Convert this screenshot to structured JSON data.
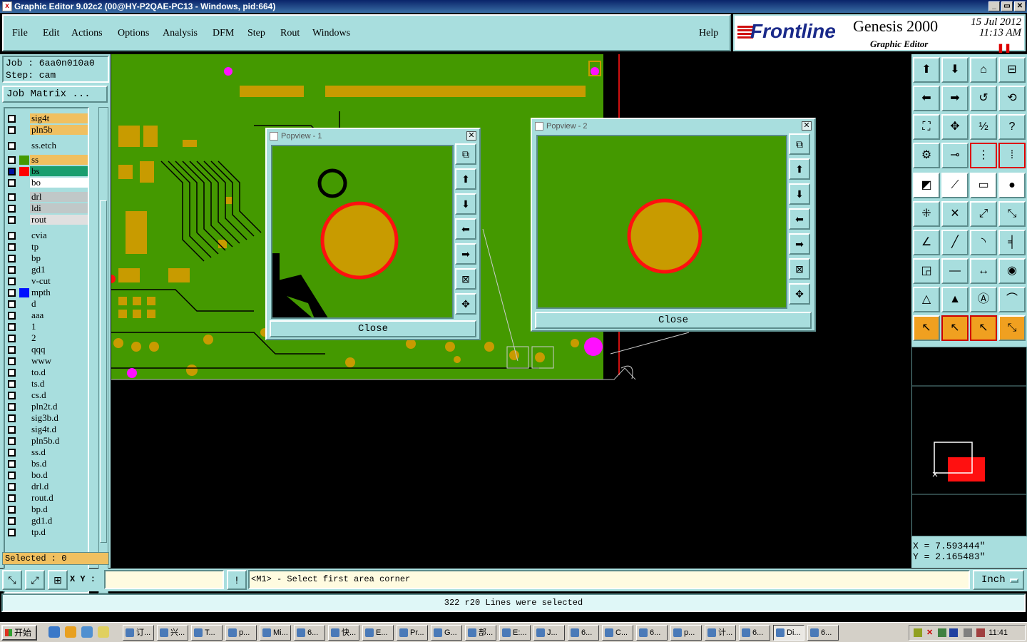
{
  "window": {
    "title": "Graphic Editor 9.02c2 (00@HY-P2QAE-PC13 - Windows, pid:664)",
    "controls": [
      "_",
      "▭",
      "✕"
    ]
  },
  "menu": {
    "items": [
      "File",
      "Edit",
      "Actions",
      "Options",
      "Analysis",
      "DFM",
      "Step",
      "Rout",
      "Windows"
    ],
    "help": "Help"
  },
  "brand": {
    "logo": "Frontline",
    "product": "Genesis 2000",
    "subtitle": "Graphic Editor",
    "date": "15 Jul 2012",
    "time": "11:13 AM"
  },
  "job": {
    "job_line": "Job : 6aa0n010a0",
    "step_line": "Step: cam",
    "matrix_button": "Job Matrix ..."
  },
  "layers": [
    {
      "name": "sig4t",
      "color": "#f0c060"
    },
    {
      "name": "pln5b",
      "color": "#f0c060"
    },
    {
      "name": "ss.etch",
      "color": "#a8dede"
    },
    {
      "name": "ss",
      "color": "#f0c060",
      "swatch": "#449900"
    },
    {
      "name": "bs",
      "color": "#1a9e6e",
      "swatch": "#ff0000",
      "active": true
    },
    {
      "name": "bo",
      "color": "#ffffff"
    },
    {
      "name": "drl",
      "color": "#c0c8c8"
    },
    {
      "name": "ldi",
      "color": "#c0c8c8"
    },
    {
      "name": "rout",
      "color": "#e0e0e0"
    },
    {
      "name": "cvia",
      "color": "#a8dede"
    },
    {
      "name": "tp",
      "color": "#a8dede"
    },
    {
      "name": "bp",
      "color": "#a8dede"
    },
    {
      "name": "gd1",
      "color": "#a8dede"
    },
    {
      "name": "v-cut",
      "color": "#a8dede"
    },
    {
      "name": "mpth",
      "color": "#a8dede",
      "swatch": "#0010ff"
    },
    {
      "name": "d",
      "color": "#a8dede"
    },
    {
      "name": "aaa",
      "color": "#a8dede"
    },
    {
      "name": "1",
      "color": "#a8dede"
    },
    {
      "name": "2",
      "color": "#a8dede"
    },
    {
      "name": "qqq",
      "color": "#a8dede"
    },
    {
      "name": "www",
      "color": "#a8dede"
    },
    {
      "name": "to.d",
      "color": "#a8dede"
    },
    {
      "name": "ts.d",
      "color": "#a8dede"
    },
    {
      "name": "cs.d",
      "color": "#a8dede"
    },
    {
      "name": "pln2t.d",
      "color": "#a8dede"
    },
    {
      "name": "sig3b.d",
      "color": "#a8dede"
    },
    {
      "name": "sig4t.d",
      "color": "#a8dede"
    },
    {
      "name": "pln5b.d",
      "color": "#a8dede"
    },
    {
      "name": "ss.d",
      "color": "#a8dede"
    },
    {
      "name": "bs.d",
      "color": "#a8dede"
    },
    {
      "name": "bo.d",
      "color": "#a8dede"
    },
    {
      "name": "drl.d",
      "color": "#a8dede"
    },
    {
      "name": "rout.d",
      "color": "#a8dede"
    },
    {
      "name": "bp.d",
      "color": "#a8dede"
    },
    {
      "name": "gd1.d",
      "color": "#a8dede"
    },
    {
      "name": "tp.d",
      "color": "#a8dede"
    }
  ],
  "selected_label": "Selected : 0",
  "popviews": [
    {
      "title": "Popview - 1",
      "close": "Close"
    },
    {
      "title": "Popview - 2",
      "close": "Close"
    }
  ],
  "coords": {
    "x": "X = 7.593444\"",
    "y": "Y = 2.165483\""
  },
  "command": {
    "xy_label": "X Y :",
    "xy_value": "",
    "prompt": "<M1> - Select first area corner",
    "unit": "Inch"
  },
  "status": "322 r20 Lines were selected",
  "taskbar": {
    "start": "开始",
    "tasks": [
      "订...",
      "兴...",
      "T...",
      "p...",
      "Mi...",
      "6...",
      "快...",
      "E...",
      "Pr...",
      "G...",
      "部...",
      "E:...",
      "J...",
      "6...",
      "C...",
      "6...",
      "p...",
      "计...",
      "6...",
      "Di...",
      "6..."
    ],
    "clock": "11:41"
  },
  "colors": {
    "panel": "#a8dede",
    "board_green": "#449900",
    "pad_gold": "#c89b00",
    "highlight_red": "#ff1010",
    "via_magenta": "#ff10ff"
  }
}
